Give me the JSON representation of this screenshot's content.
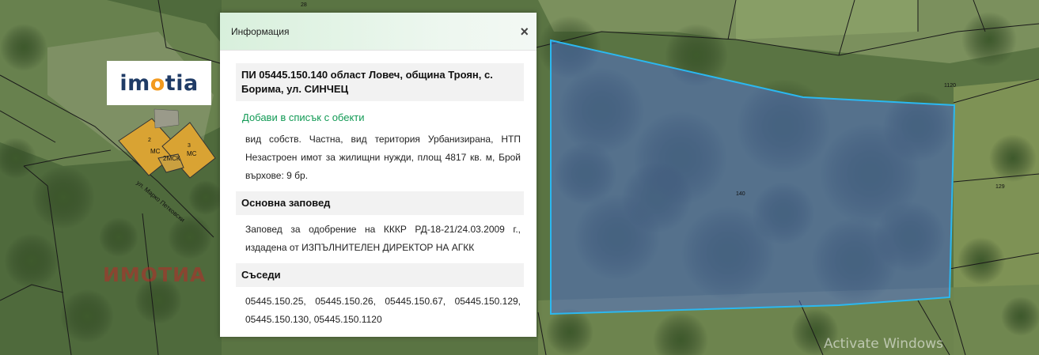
{
  "map": {
    "parcel_labels": {
      "top": "28",
      "neighbor_1120": "1120",
      "main_parcel": "140",
      "neighbor_129": "129",
      "building_2": "2",
      "building_3": "3",
      "building_mark_1": "МС",
      "building_mark_2": "МС",
      "building_mark_3": "2МСК",
      "street": "ул. Марко Петковски"
    },
    "colors": {
      "parcel_outline": "#2bb8f0",
      "parcel_fill": "rgba(80,110,230,0.45)",
      "building_fill": "#d9a333"
    }
  },
  "logo": {
    "text_pre": "im",
    "text_accent": "o",
    "text_post": "tia"
  },
  "watermark": "ИМОТИА",
  "os_watermark": "Activate Windows",
  "info_panel": {
    "title": "Информация",
    "close_label": "×",
    "parcel_heading": "ПИ 05445.150.140 област Ловеч, община Троян, с. Борима, ул. СИНЧЕЦ",
    "add_link": "Добави в списък с обекти",
    "details": "вид собств. Частна, вид територия Урбанизирана, НТП Незастроен имот за жилищни нужди, площ 4817 кв. м, Брой върхове: 9 бр.",
    "order_heading": "Основна заповед",
    "order_text": "Заповед за одобрение на КККР РД-18-21/24.03.2009 г., издадена от ИЗПЪЛНИТЕЛЕН ДИРЕКТОР НА АГКК",
    "neighbors_heading": "Съседи",
    "neighbors_text": "05445.150.25, 05445.150.26, 05445.150.67, 05445.150.129, 05445.150.130, 05445.150.1120"
  }
}
